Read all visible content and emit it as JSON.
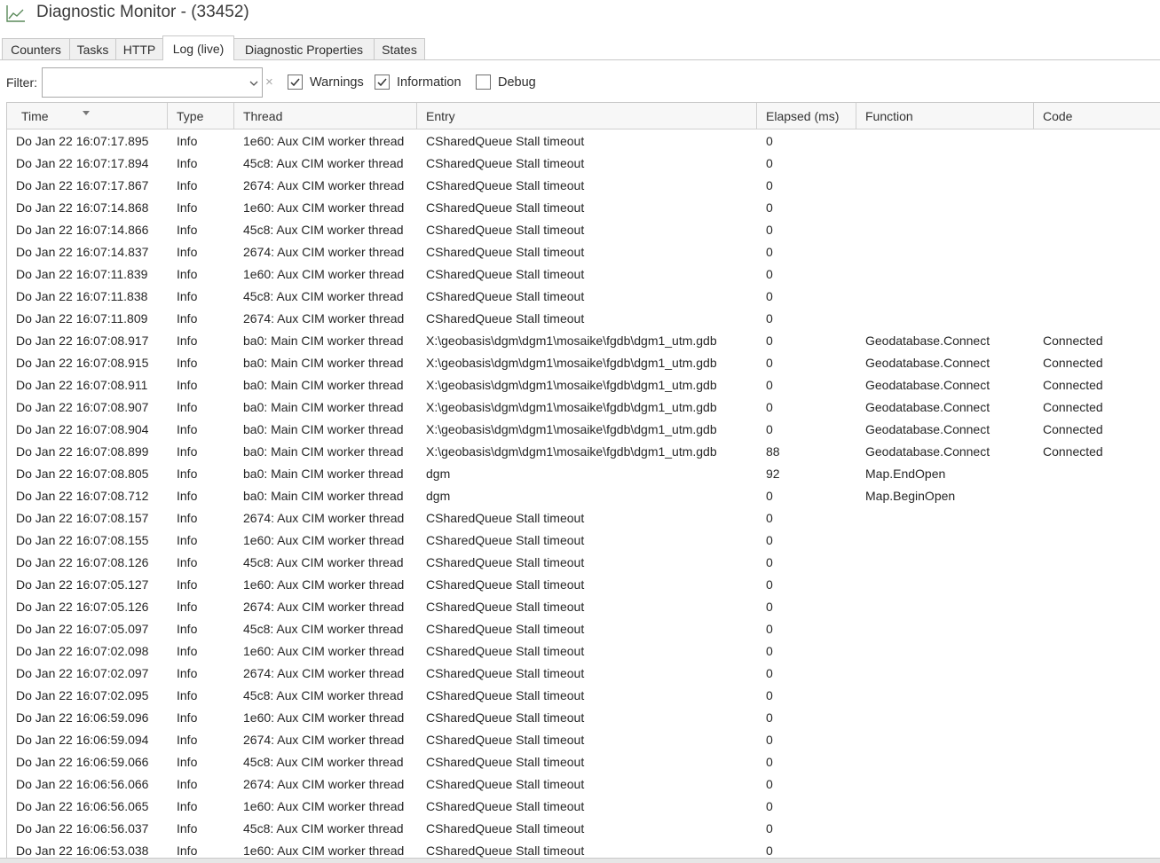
{
  "window": {
    "title": "Diagnostic Monitor - (33452)",
    "icon": "line-chart-icon"
  },
  "tabs": [
    {
      "label": "Counters",
      "active": false
    },
    {
      "label": "Tasks",
      "active": false
    },
    {
      "label": "HTTP",
      "active": false
    },
    {
      "label": "Log (live)",
      "active": true
    },
    {
      "label": "Diagnostic Properties",
      "active": false
    },
    {
      "label": "States",
      "active": false
    }
  ],
  "filter": {
    "label": "Filter:",
    "value": "",
    "clear_glyph": "×",
    "checkboxes": [
      {
        "label": "Warnings",
        "checked": true
      },
      {
        "label": "Information",
        "checked": true
      },
      {
        "label": "Debug",
        "checked": false
      }
    ]
  },
  "grid": {
    "columns": [
      "Time",
      "Type",
      "Thread",
      "Entry",
      "Elapsed (ms)",
      "Function",
      "Code"
    ],
    "sorted_column": "Time",
    "rows": [
      [
        "Do Jan 22 16:07:17.895",
        "Info",
        "1e60: Aux CIM worker thread",
        "CSharedQueue Stall timeout",
        "0",
        "",
        ""
      ],
      [
        "Do Jan 22 16:07:17.894",
        "Info",
        "45c8: Aux CIM worker thread",
        "CSharedQueue Stall timeout",
        "0",
        "",
        ""
      ],
      [
        "Do Jan 22 16:07:17.867",
        "Info",
        "2674: Aux CIM worker thread",
        "CSharedQueue Stall timeout",
        "0",
        "",
        ""
      ],
      [
        "Do Jan 22 16:07:14.868",
        "Info",
        "1e60: Aux CIM worker thread",
        "CSharedQueue Stall timeout",
        "0",
        "",
        ""
      ],
      [
        "Do Jan 22 16:07:14.866",
        "Info",
        "45c8: Aux CIM worker thread",
        "CSharedQueue Stall timeout",
        "0",
        "",
        ""
      ],
      [
        "Do Jan 22 16:07:14.837",
        "Info",
        "2674: Aux CIM worker thread",
        "CSharedQueue Stall timeout",
        "0",
        "",
        ""
      ],
      [
        "Do Jan 22 16:07:11.839",
        "Info",
        "1e60: Aux CIM worker thread",
        "CSharedQueue Stall timeout",
        "0",
        "",
        ""
      ],
      [
        "Do Jan 22 16:07:11.838",
        "Info",
        "45c8: Aux CIM worker thread",
        "CSharedQueue Stall timeout",
        "0",
        "",
        ""
      ],
      [
        "Do Jan 22 16:07:11.809",
        "Info",
        "2674: Aux CIM worker thread",
        "CSharedQueue Stall timeout",
        "0",
        "",
        ""
      ],
      [
        "Do Jan 22 16:07:08.917",
        "Info",
        "ba0: Main CIM worker thread",
        "X:\\geobasis\\dgm\\dgm1\\mosaike\\fgdb\\dgm1_utm.gdb",
        "0",
        "Geodatabase.Connect",
        "Connected"
      ],
      [
        "Do Jan 22 16:07:08.915",
        "Info",
        "ba0: Main CIM worker thread",
        "X:\\geobasis\\dgm\\dgm1\\mosaike\\fgdb\\dgm1_utm.gdb",
        "0",
        "Geodatabase.Connect",
        "Connected"
      ],
      [
        "Do Jan 22 16:07:08.911",
        "Info",
        "ba0: Main CIM worker thread",
        "X:\\geobasis\\dgm\\dgm1\\mosaike\\fgdb\\dgm1_utm.gdb",
        "0",
        "Geodatabase.Connect",
        "Connected"
      ],
      [
        "Do Jan 22 16:07:08.907",
        "Info",
        "ba0: Main CIM worker thread",
        "X:\\geobasis\\dgm\\dgm1\\mosaike\\fgdb\\dgm1_utm.gdb",
        "0",
        "Geodatabase.Connect",
        "Connected"
      ],
      [
        "Do Jan 22 16:07:08.904",
        "Info",
        "ba0: Main CIM worker thread",
        "X:\\geobasis\\dgm\\dgm1\\mosaike\\fgdb\\dgm1_utm.gdb",
        "0",
        "Geodatabase.Connect",
        "Connected"
      ],
      [
        "Do Jan 22 16:07:08.899",
        "Info",
        "ba0: Main CIM worker thread",
        "X:\\geobasis\\dgm\\dgm1\\mosaike\\fgdb\\dgm1_utm.gdb",
        "88",
        "Geodatabase.Connect",
        "Connected"
      ],
      [
        "Do Jan 22 16:07:08.805",
        "Info",
        "ba0: Main CIM worker thread",
        "dgm",
        "92",
        "Map.EndOpen",
        ""
      ],
      [
        "Do Jan 22 16:07:08.712",
        "Info",
        "ba0: Main CIM worker thread",
        "dgm",
        "0",
        "Map.BeginOpen",
        ""
      ],
      [
        "Do Jan 22 16:07:08.157",
        "Info",
        "2674: Aux CIM worker thread",
        "CSharedQueue Stall timeout",
        "0",
        "",
        ""
      ],
      [
        "Do Jan 22 16:07:08.155",
        "Info",
        "1e60: Aux CIM worker thread",
        "CSharedQueue Stall timeout",
        "0",
        "",
        ""
      ],
      [
        "Do Jan 22 16:07:08.126",
        "Info",
        "45c8: Aux CIM worker thread",
        "CSharedQueue Stall timeout",
        "0",
        "",
        ""
      ],
      [
        "Do Jan 22 16:07:05.127",
        "Info",
        "1e60: Aux CIM worker thread",
        "CSharedQueue Stall timeout",
        "0",
        "",
        ""
      ],
      [
        "Do Jan 22 16:07:05.126",
        "Info",
        "2674: Aux CIM worker thread",
        "CSharedQueue Stall timeout",
        "0",
        "",
        ""
      ],
      [
        "Do Jan 22 16:07:05.097",
        "Info",
        "45c8: Aux CIM worker thread",
        "CSharedQueue Stall timeout",
        "0",
        "",
        ""
      ],
      [
        "Do Jan 22 16:07:02.098",
        "Info",
        "1e60: Aux CIM worker thread",
        "CSharedQueue Stall timeout",
        "0",
        "",
        ""
      ],
      [
        "Do Jan 22 16:07:02.097",
        "Info",
        "2674: Aux CIM worker thread",
        "CSharedQueue Stall timeout",
        "0",
        "",
        ""
      ],
      [
        "Do Jan 22 16:07:02.095",
        "Info",
        "45c8: Aux CIM worker thread",
        "CSharedQueue Stall timeout",
        "0",
        "",
        ""
      ],
      [
        "Do Jan 22 16:06:59.096",
        "Info",
        "1e60: Aux CIM worker thread",
        "CSharedQueue Stall timeout",
        "0",
        "",
        ""
      ],
      [
        "Do Jan 22 16:06:59.094",
        "Info",
        "2674: Aux CIM worker thread",
        "CSharedQueue Stall timeout",
        "0",
        "",
        ""
      ],
      [
        "Do Jan 22 16:06:59.066",
        "Info",
        "45c8: Aux CIM worker thread",
        "CSharedQueue Stall timeout",
        "0",
        "",
        ""
      ],
      [
        "Do Jan 22 16:06:56.066",
        "Info",
        "2674: Aux CIM worker thread",
        "CSharedQueue Stall timeout",
        "0",
        "",
        ""
      ],
      [
        "Do Jan 22 16:06:56.065",
        "Info",
        "1e60: Aux CIM worker thread",
        "CSharedQueue Stall timeout",
        "0",
        "",
        ""
      ],
      [
        "Do Jan 22 16:06:56.037",
        "Info",
        "45c8: Aux CIM worker thread",
        "CSharedQueue Stall timeout",
        "0",
        "",
        ""
      ],
      [
        "Do Jan 22 16:06:53.038",
        "Info",
        "1e60: Aux CIM worker thread",
        "CSharedQueue Stall timeout",
        "0",
        "",
        ""
      ]
    ]
  }
}
